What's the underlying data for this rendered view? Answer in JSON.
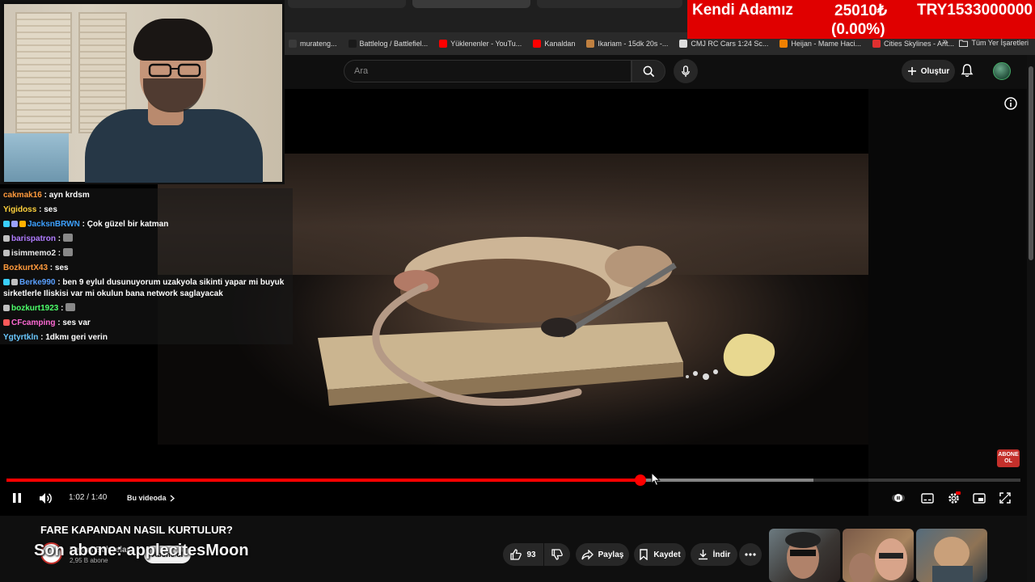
{
  "ticker": {
    "name": "Kendi Adamız",
    "price": "25010₺",
    "cap": "TRY1533000000",
    "change": "(0.00%)"
  },
  "bookmarks": [
    {
      "label": "murateng...",
      "icon": "globe-icon",
      "color": "#3a3a3a"
    },
    {
      "label": "Battlelog / Battlefiel...",
      "icon": "bl-icon",
      "color": "#1a1a1a"
    },
    {
      "label": "Yüklenenler - YouTu...",
      "icon": "youtube-icon",
      "color": "#ff0000"
    },
    {
      "label": "Kanaldan",
      "icon": "youtube-icon",
      "color": "#ff0000"
    },
    {
      "label": "Ikariam - 15dk 20s -...",
      "icon": "ikariam-icon",
      "color": "#c08040"
    },
    {
      "label": "CMJ RC Cars 1:24 Sc...",
      "icon": "page-icon",
      "color": "#dddddd"
    },
    {
      "label": "Heijan - Mame Haci...",
      "icon": "orange-icon",
      "color": "#f08000"
    },
    {
      "label": "Cities Skylines - Ant...",
      "icon": "cities-icon",
      "color": "#e03030"
    }
  ],
  "bookmarks_more": "»",
  "bookmarks_folder": "Tüm Yer İşaretleri",
  "header": {
    "search_placeholder": "Ara",
    "create_label": "Oluştur"
  },
  "chat": [
    {
      "user": "cakmak16",
      "color": "#ff9a3c",
      "text": "ayn krdsm",
      "badges": []
    },
    {
      "user": "Yigidoss",
      "color": "#ffd23c",
      "text": "ses",
      "badges": []
    },
    {
      "user": "JacksnBRWN",
      "color": "#3ca0ff",
      "text": "Çok güzel bir katman",
      "badges": [
        "#3ad0ff",
        "#9aa0ff",
        "#ffb000"
      ]
    },
    {
      "user": "barispatron",
      "color": "#b07cff",
      "text": "",
      "badges": [
        "#c0c0c0"
      ],
      "emote": true
    },
    {
      "user": "isimmemo2",
      "color": "#e8e8e8",
      "text": "",
      "badges": [
        "#c0c0c0"
      ],
      "emote": true
    },
    {
      "user": "BozkurtX43",
      "color": "#ff9a3c",
      "text": "ses",
      "badges": []
    },
    {
      "user": "Berke990",
      "color": "#5aa0ff",
      "text": "ben 9 eylul dusunuyorum uzakyola sikinti yapar mi buyuk sirketlerle Iliskisi var mi okulun bana network saglayacak",
      "badges": [
        "#3ad0ff",
        "#c0c0c0"
      ]
    },
    {
      "user": "bozkurt1923",
      "color": "#4cff6a",
      "text": "",
      "badges": [
        "#c0c0c0"
      ],
      "emote": true
    },
    {
      "user": "CFcamping",
      "color": "#ff6ad5",
      "text": "ses var",
      "badges": [
        "#ff5a5a"
      ]
    },
    {
      "user": "Ygtyrtkln",
      "color": "#6ac8ff",
      "text": "1dkmı geri verin",
      "badges": []
    }
  ],
  "player": {
    "time": "1:02 / 1:40",
    "chapter": "Bu videoda",
    "progress_played": 0.625,
    "progress_buffered": 0.796,
    "subscribe_badge": "ABONE OL"
  },
  "video": {
    "title": "FARE KAPANDAN NASIL KURTULUR?",
    "channel": "Fehmi Bahçelar",
    "subs": "2,95 B abone",
    "subscribe_label": "Abone ol",
    "overlay_text": "Son abone: applecitesMoon",
    "likes": "93",
    "share_label": "Paylaş",
    "save_label": "Kaydet",
    "download_label": "İndir"
  },
  "colors": {
    "accent_red": "#ff0000",
    "ticker_red": "#e00000",
    "youtube_bg": "#0f0f0f"
  }
}
